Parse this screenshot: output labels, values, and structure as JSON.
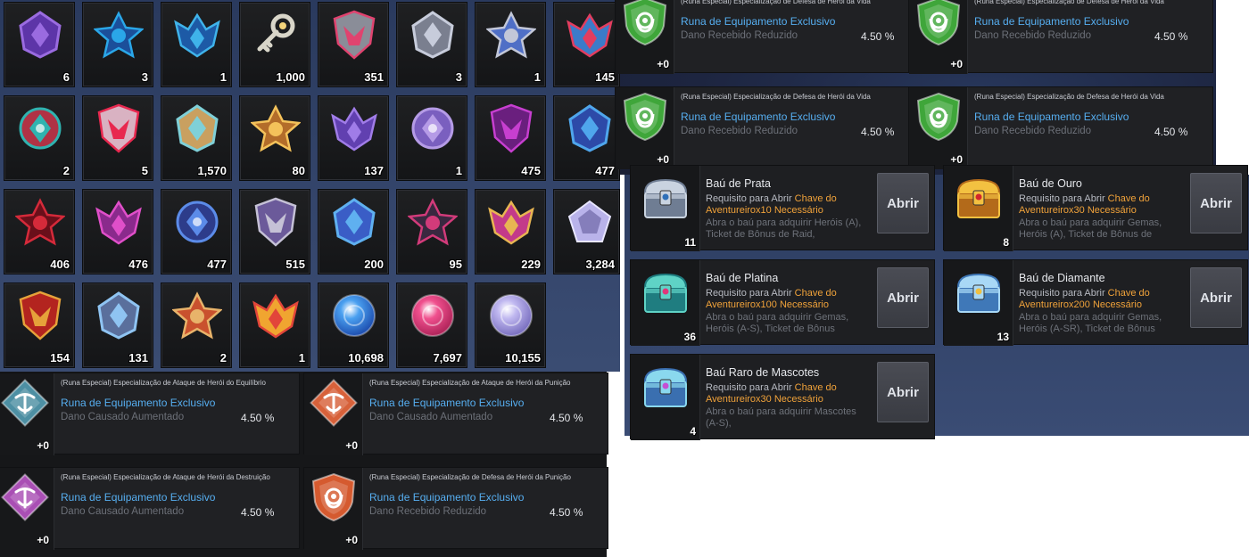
{
  "inventory": [
    {
      "icon": "purple-gem-book-icon",
      "qty": "6"
    },
    {
      "icon": "blue-crest-icon",
      "qty": "3"
    },
    {
      "icon": "blue-crest-alt-icon",
      "qty": "1"
    },
    {
      "icon": "silver-key-icon",
      "qty": "1,000"
    },
    {
      "icon": "silver-pink-emblem-icon",
      "qty": "351"
    },
    {
      "icon": "silver-wings-icon",
      "qty": "3"
    },
    {
      "icon": "silver-blue-emblem-icon",
      "qty": "1"
    },
    {
      "icon": "red-blue-crest-icon",
      "qty": "145"
    },
    {
      "icon": "dark-teal-crest-icon",
      "qty": "2"
    },
    {
      "icon": "red-heart-gem-icon",
      "qty": "5"
    },
    {
      "icon": "yarn-ball-icon",
      "qty": "1,570"
    },
    {
      "icon": "gold-burst-icon",
      "qty": "80"
    },
    {
      "icon": "violet-star-icon",
      "qty": "137"
    },
    {
      "icon": "lilac-star-icon",
      "qty": "1"
    },
    {
      "icon": "magenta-crest-icon",
      "qty": "475"
    },
    {
      "icon": "blue-star-crest-icon",
      "qty": "477"
    },
    {
      "icon": "red-eye-crest-icon",
      "qty": "406"
    },
    {
      "icon": "pink-crest-icon",
      "qty": "476"
    },
    {
      "icon": "blue-wing-crest-icon",
      "qty": "477"
    },
    {
      "icon": "silver-purple-crest-icon",
      "qty": "515"
    },
    {
      "icon": "blue-diamond-crest-icon",
      "qty": "200"
    },
    {
      "icon": "dark-pink-orb-icon",
      "qty": "95"
    },
    {
      "icon": "gold-pink-crest-icon",
      "qty": "229"
    },
    {
      "icon": "pentagon-gem-icon",
      "qty": "3,284"
    },
    {
      "icon": "gold-red-medal-icon",
      "qty": "154"
    },
    {
      "icon": "silver-blue-diamond-icon",
      "qty": "131"
    },
    {
      "icon": "gold-star-icon",
      "qty": "2"
    },
    {
      "icon": "red-flame-crest-icon",
      "qty": "1"
    },
    {
      "icon": "blue-orb-icon",
      "qty": "10,698"
    },
    {
      "icon": "pink-orb-icon",
      "qty": "7,697"
    },
    {
      "icon": "lavender-orb-icon",
      "qty": "10,155"
    }
  ],
  "runes_top": [
    {
      "spec": "(Runa Especial) Especialização de Defesa de Herói da Vida",
      "title": "Runa de Equipamento Exclusivo",
      "stat": "Dano Recebido Reduzido",
      "value": "4.50 %",
      "plus": "+0",
      "icon": "green-shield-rune-icon",
      "color": "#3fa63a"
    },
    {
      "spec": "(Runa Especial) Especialização de Defesa de Herói da Vida",
      "title": "Runa de Equipamento Exclusivo",
      "stat": "Dano Recebido Reduzido",
      "value": "4.50 %",
      "plus": "+0",
      "icon": "green-shield-rune-icon",
      "color": "#3fa63a"
    },
    {
      "spec": "(Runa Especial) Especialização de Defesa de Herói da Vida",
      "title": "Runa de Equipamento Exclusivo",
      "stat": "Dano Recebido Reduzido",
      "value": "4.50 %",
      "plus": "+0",
      "icon": "green-shield-rune-icon",
      "color": "#3fa63a"
    },
    {
      "spec": "(Runa Especial) Especialização de Defesa de Herói da Vida",
      "title": "Runa de Equipamento Exclusivo",
      "stat": "Dano Recebido Reduzido",
      "value": "4.50 %",
      "plus": "+0",
      "icon": "green-shield-rune-icon",
      "color": "#3fa63a"
    }
  ],
  "runes_bottom": [
    {
      "spec": "(Runa Especial) Especialização de Ataque de Herói do Equilíbrio",
      "title": "Runa de Equipamento Exclusivo",
      "stat": "Dano Causado Aumentado",
      "value": "4.50 %",
      "plus": "+0",
      "icon": "teal-diamond-rune-icon",
      "color": "#4d8fa3"
    },
    {
      "spec": "(Runa Especial) Especialização de Ataque de Herói da Punição",
      "title": "Runa de Equipamento Exclusivo",
      "stat": "Dano Causado Aumentado",
      "value": "4.50 %",
      "plus": "+0",
      "icon": "orange-diamond-rune-icon",
      "color": "#d7613a"
    },
    {
      "spec": "(Runa Especial) Especialização de Ataque de Herói da Destruição",
      "title": "Runa de Equipamento Exclusivo",
      "stat": "Dano Causado Aumentado",
      "value": "4.50 %",
      "plus": "+0",
      "icon": "violet-diamond-rune-icon",
      "color": "#a94fb4"
    },
    {
      "spec": "(Runa Especial) Especialização de Defesa de Herói da Punição",
      "title": "Runa de Equipamento Exclusivo",
      "stat": "Dano Recebido Reduzido",
      "value": "4.50 %",
      "plus": "+0",
      "icon": "orange-shield-rune-icon",
      "color": "#d55a2f"
    }
  ],
  "chests": [
    {
      "name": "Baú de Prata",
      "req_prefix": "Requisito para Abrir",
      "req_key": "Chave do Aventureirox10 Necessário",
      "desc": "Abra o baú para adquirir Heróis (A), Ticket de Bônus de Raid,",
      "count": "11",
      "button": "Abrir",
      "icon": "silver-chest-icon"
    },
    {
      "name": "Baú de Ouro",
      "req_prefix": "Requisito para Abrir",
      "req_key": "Chave do Aventureirox30 Necessário",
      "desc": "Abra o baú para adquirir Gemas, Heróis (A), Ticket de Bônus de",
      "count": "8",
      "button": "Abrir",
      "icon": "gold-chest-icon"
    },
    {
      "name": "Baú de Platina",
      "req_prefix": "Requisito para Abrir",
      "req_key": "Chave do Aventureirox100 Necessário",
      "desc": "Abra o baú para adquirir Gemas, Heróis (A-S), Ticket de Bônus",
      "count": "36",
      "button": "Abrir",
      "icon": "platinum-chest-icon"
    },
    {
      "name": "Baú de Diamante",
      "req_prefix": "Requisito para Abrir",
      "req_key": "Chave do Aventureirox200 Necessário",
      "desc": "Abra o baú para adquirir Gemas, Heróis (A-SR), Ticket de Bônus",
      "count": "13",
      "button": "Abrir",
      "icon": "diamond-chest-icon"
    },
    {
      "name": "Baú Raro de Mascotes",
      "req_prefix": "Requisito para Abrir",
      "req_key": "Chave do Aventureirox30 Necessário",
      "desc": "Abra o baú para adquirir Mascotes (A-S),",
      "count": "4",
      "button": "Abrir",
      "icon": "pet-chest-icon"
    }
  ]
}
